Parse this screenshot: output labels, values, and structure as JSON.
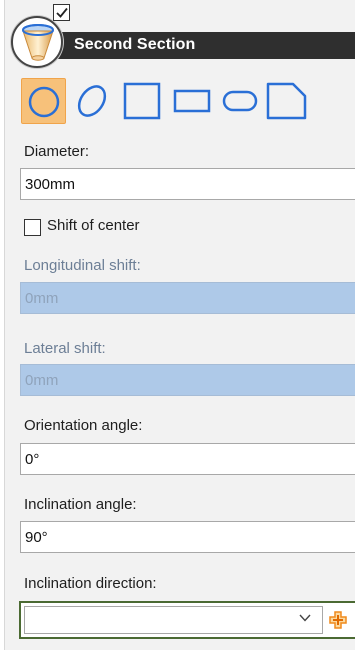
{
  "header": {
    "title": "Second Section",
    "icon": "cone-section-icon",
    "enable_checked": true
  },
  "shapes": [
    {
      "name": "circle",
      "selected": true
    },
    {
      "name": "ellipse",
      "selected": false
    },
    {
      "name": "square",
      "selected": false
    },
    {
      "name": "rectangle",
      "selected": false
    },
    {
      "name": "rounded-rectangle",
      "selected": false
    },
    {
      "name": "chamfered-square",
      "selected": false
    }
  ],
  "form": {
    "diameter": {
      "label": "Diameter:",
      "value": "300mm"
    },
    "shift_of_center": {
      "label": "Shift of center",
      "checked": false
    },
    "longitudinal_shift": {
      "label": "Longitudinal shift:",
      "value": "0mm",
      "disabled": true
    },
    "lateral_shift": {
      "label": "Lateral shift:",
      "value": "0mm",
      "disabled": true
    },
    "orientation_angle": {
      "label": "Orientation angle:",
      "value": "0°"
    },
    "inclination_angle": {
      "label": "Inclination angle:",
      "value": "90°"
    },
    "inclination_direction": {
      "label": "Inclination direction:",
      "value": ""
    }
  },
  "colors": {
    "accent": "#2a6fd6",
    "selected_bg": "#f7c17a",
    "disabled_bg": "#aec9e8",
    "header_bg": "#2f2f2f",
    "add_icon": "#f08a1c"
  }
}
